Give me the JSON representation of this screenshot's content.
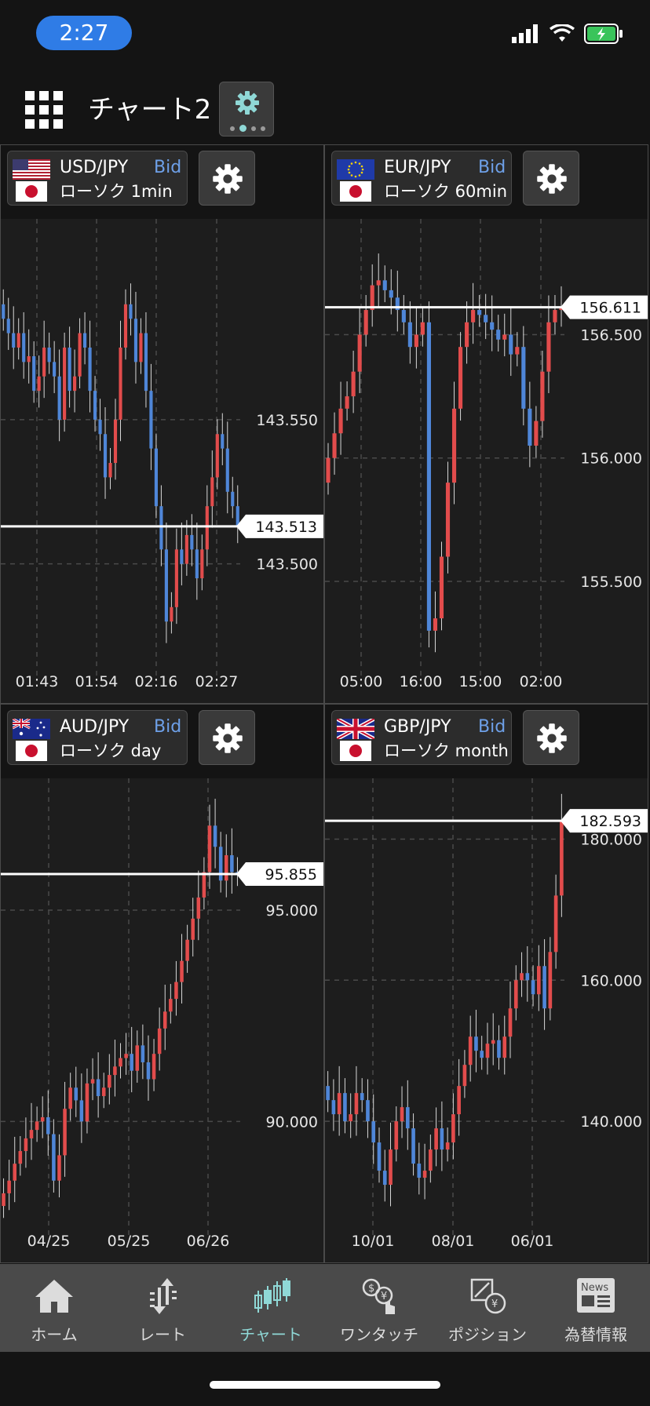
{
  "status": {
    "time": "2:27"
  },
  "header": {
    "title": "チャート2"
  },
  "colors": {
    "up": "#e24c4c",
    "down": "#4f86d8",
    "accent": "#8fd8d6",
    "bid": "#6ea0e8"
  },
  "charts": [
    {
      "pair": "USD/JPY",
      "bid": "Bid",
      "type": "ローソク 1min",
      "flag": "us",
      "price_label": "143.513",
      "current": 143.513,
      "ymin": 143.464,
      "ymax": 143.612,
      "y_ticks": [
        {
          "v": 143.55,
          "label": "143.550"
        },
        {
          "v": 143.5,
          "label": "143.500"
        }
      ],
      "x_labels": [
        "01:43",
        "01:54",
        "02:16",
        "02:27"
      ],
      "closes": [
        143.585,
        143.58,
        143.575,
        143.58,
        143.57,
        143.572,
        143.56,
        143.565,
        143.575,
        143.57,
        143.565,
        143.55,
        143.575,
        143.56,
        143.565,
        143.58,
        143.575,
        143.56,
        143.55,
        143.545,
        143.53,
        143.535,
        143.55,
        143.575,
        143.59,
        143.585,
        143.57,
        143.58,
        143.56,
        143.54,
        143.52,
        143.505,
        143.48,
        143.485,
        143.505,
        143.5,
        143.51,
        143.505,
        143.495,
        143.505,
        143.52,
        143.53,
        143.545,
        143.54,
        143.525,
        143.52,
        143.513
      ],
      "chart_data": {
        "type": "candlestick",
        "x_ticks": [
          "01:43",
          "01:54",
          "02:16",
          "02:27"
        ],
        "y_ticks": [
          "143.550",
          "143.500"
        ],
        "current_price": 143.513
      }
    },
    {
      "pair": "EUR/JPY",
      "bid": "Bid",
      "type": "ローソク 60min",
      "flag": "eu",
      "price_label": "156.611",
      "current": 156.611,
      "ymin": 155.15,
      "ymax": 156.88,
      "y_ticks": [
        {
          "v": 156.5,
          "label": "156.500"
        },
        {
          "v": 156.0,
          "label": "156.000"
        },
        {
          "v": 155.5,
          "label": "155.500"
        }
      ],
      "x_labels": [
        "05:00",
        "16:00",
        "15:00",
        "02:00"
      ],
      "closes": [
        156.0,
        156.1,
        156.2,
        156.25,
        156.35,
        156.5,
        156.6,
        156.7,
        156.72,
        156.68,
        156.65,
        156.6,
        156.55,
        156.45,
        156.5,
        156.55,
        155.3,
        155.35,
        155.6,
        155.9,
        156.2,
        156.45,
        156.55,
        156.6,
        156.58,
        156.55,
        156.52,
        156.48,
        156.5,
        156.42,
        156.45,
        156.2,
        156.05,
        156.15,
        156.35,
        156.55,
        156.6,
        156.611
      ],
      "chart_data": {
        "type": "candlestick",
        "x_ticks": [
          "05:00",
          "16:00",
          "15:00",
          "02:00"
        ],
        "y_ticks": [
          "156.500",
          "156.000",
          "155.500"
        ],
        "current_price": 156.611
      }
    },
    {
      "pair": "AUD/JPY",
      "bid": "Bid",
      "type": "ローソク day",
      "flag": "au",
      "price_label": "95.855",
      "current": 95.855,
      "ymin": 87.5,
      "ymax": 97.6,
      "y_ticks": [
        {
          "v": 95.0,
          "label": "95.000"
        },
        {
          "v": 90.0,
          "label": "90.000"
        }
      ],
      "x_labels": [
        "04/25",
        "05/25",
        "06/26"
      ],
      "closes": [
        88.3,
        88.6,
        89.0,
        89.3,
        89.6,
        89.8,
        90.0,
        90.1,
        89.7,
        88.6,
        89.2,
        90.3,
        90.8,
        90.5,
        90.0,
        90.9,
        91.0,
        90.6,
        90.8,
        91.1,
        91.3,
        91.5,
        91.6,
        91.2,
        91.8,
        91.4,
        91.0,
        91.6,
        92.2,
        92.6,
        92.9,
        93.3,
        93.8,
        94.3,
        94.8,
        95.3,
        95.9,
        97.0,
        96.5,
        95.7,
        96.3,
        95.9,
        95.855
      ],
      "chart_data": {
        "type": "candlestick",
        "x_ticks": [
          "04/25",
          "05/25",
          "06/26"
        ],
        "y_ticks": [
          "95.000",
          "90.000"
        ],
        "current_price": 95.855
      }
    },
    {
      "pair": "GBP/JPY",
      "bid": "Bid",
      "type": "ローソク month",
      "flag": "gb",
      "price_label": "182.593",
      "current": 182.593,
      "ymin": 125.0,
      "ymax": 185.5,
      "y_ticks": [
        {
          "v": 180.0,
          "label": "180.000"
        },
        {
          "v": 160.0,
          "label": "160.000"
        },
        {
          "v": 140.0,
          "label": "140.000"
        }
      ],
      "x_labels": [
        "10/01",
        "08/01",
        "06/01"
      ],
      "closes": [
        143.0,
        141.0,
        144.0,
        140.0,
        141.0,
        144.0,
        143.0,
        140.0,
        137.0,
        133.0,
        131.0,
        136.0,
        140.0,
        142.0,
        139.0,
        134.0,
        132.0,
        133.0,
        136.0,
        139.0,
        136.0,
        137.0,
        141.0,
        145.0,
        148.0,
        152.0,
        150.0,
        149.0,
        151.0,
        151.5,
        149.0,
        152.0,
        156.0,
        160.0,
        161.0,
        160.0,
        158.0,
        162.0,
        156.0,
        164.0,
        172.0,
        182.593
      ],
      "chart_data": {
        "type": "candlestick",
        "x_ticks": [
          "10/01",
          "08/01",
          "06/01"
        ],
        "y_ticks": [
          "180.000",
          "160.000",
          "140.000"
        ],
        "current_price": 182.593
      }
    }
  ],
  "tabs": [
    {
      "label": "ホーム",
      "icon": "home-icon",
      "active": false
    },
    {
      "label": "レート",
      "icon": "rate-arrows-icon",
      "active": false
    },
    {
      "label": "チャート",
      "icon": "candle-chart-icon",
      "active": true
    },
    {
      "label": "ワンタッチ",
      "icon": "one-touch-icon",
      "active": false
    },
    {
      "label": "ポジション",
      "icon": "position-icon",
      "active": false
    },
    {
      "label": "為替情報",
      "icon": "news-icon",
      "active": false
    }
  ],
  "news_label": "News"
}
